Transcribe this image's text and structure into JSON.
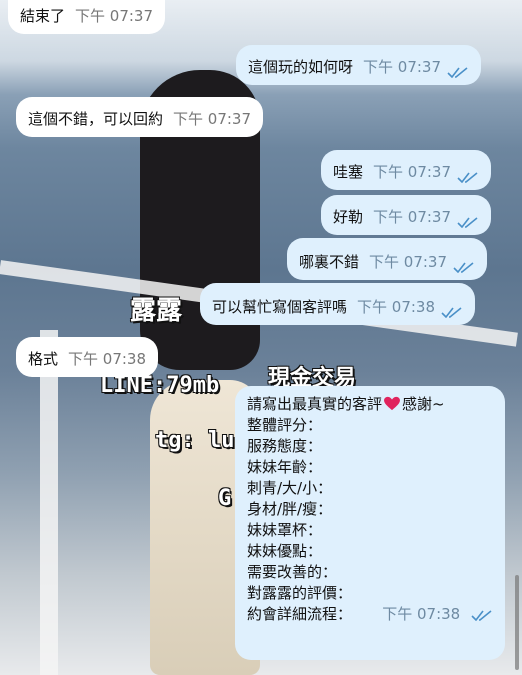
{
  "messages": [
    {
      "dir": "in",
      "text": "結束了",
      "time": "下午 07:37"
    },
    {
      "dir": "out",
      "text": "這個玩的如何呀",
      "time": "下午 07:37",
      "read": true
    },
    {
      "dir": "in",
      "text": "這個不錯，可以回約",
      "time": "下午 07:37"
    },
    {
      "dir": "out",
      "text": "哇塞",
      "time": "下午 07:37",
      "read": true
    },
    {
      "dir": "out",
      "text": "好勒",
      "time": "下午 07:37",
      "read": true
    },
    {
      "dir": "out",
      "text": "哪裏不錯",
      "time": "下午 07:37",
      "read": true
    },
    {
      "dir": "out",
      "text": "可以幫忙寫個客評嗎",
      "time": "下午 07:38",
      "read": true
    },
    {
      "dir": "in",
      "text": "格式",
      "time": "下午 07:38"
    },
    {
      "dir": "out",
      "lines": [
        "請寫出最真實的客評",
        "整體評分：",
        "服務態度：",
        "妹妹年齡：",
        "刺青/大/小：",
        "身材/胖/瘦：",
        "妹妹罩杯：",
        "妹妹優點：",
        "需要改善的：",
        "對露露的評價：",
        "約會詳細流程："
      ],
      "heart_suffix": "感謝~",
      "time": "下午 07:38",
      "read": true
    }
  ],
  "watermarks": {
    "name": "露露",
    "line": "LINE:79mb",
    "tg": "tg: lu",
    "brand": "現金交易",
    "letter": "G"
  },
  "icons": {
    "read_receipt": "double-check-icon",
    "heart": "heart-icon"
  },
  "colors": {
    "outgoing": "#dff0fd",
    "incoming": "#ffffff",
    "check": "#4a90c8",
    "heart": "#e0245e"
  }
}
